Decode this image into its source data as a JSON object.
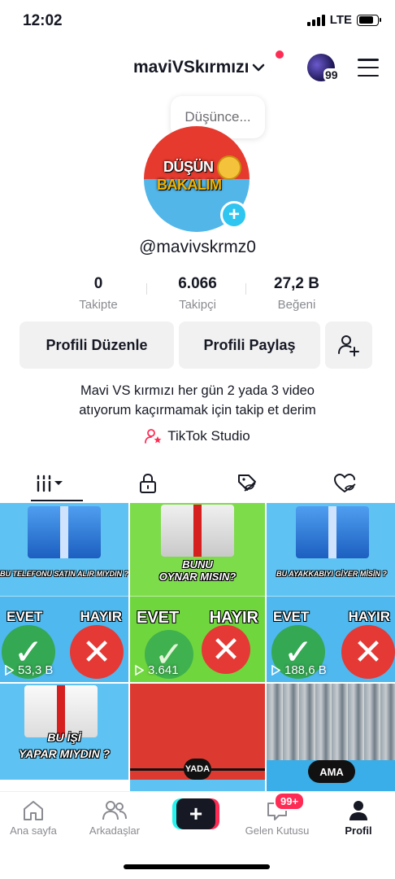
{
  "status_bar": {
    "time": "12:02",
    "network": "LTE"
  },
  "header": {
    "username": "maviVSkırmızı",
    "notification_count": "99"
  },
  "profile": {
    "thought_placeholder": "Düşünce...",
    "avatar_text_line1": "DÜŞÜN",
    "avatar_text_line2": "BAKALIM",
    "handle": "@mavivskrmz0",
    "stats": [
      {
        "value": "0",
        "label": "Takipte"
      },
      {
        "value": "6.066",
        "label": "Takipçi"
      },
      {
        "value": "27,2 B",
        "label": "Beğeni"
      }
    ],
    "buttons": {
      "edit": "Profili Düzenle",
      "share": "Profili Paylaş"
    },
    "bio_line1": "Mavi VS kırmızı her gün 2 yada 3 video",
    "bio_line2": "atıyorum kaçırmamak için takip et derim",
    "studio": "TikTok Studio"
  },
  "videos": [
    {
      "question": "BU TELEFONU SATIN ALIR MIYDIN ?",
      "yes": "EVET",
      "no": "HAYIR",
      "views": "53,3 B"
    },
    {
      "question_line1": "BUNU",
      "question_line2": "OYNAR MISIN?",
      "yes": "EVET",
      "no": "HAYIR",
      "views": "3.641"
    },
    {
      "question": "BU AYAKKABIYI GİYER MİSİN ?",
      "yes": "EVET",
      "no": "HAYIR",
      "views": "188,6 B"
    },
    {
      "question_line1": "BU İŞİ",
      "question_line2": "YAPAR MIYDIN ?"
    },
    {
      "label": "YADA"
    },
    {
      "label": "AMA"
    }
  ],
  "bottom_nav": {
    "home": "Ana sayfa",
    "friends": "Arkadaşlar",
    "inbox": "Gelen Kutusu",
    "inbox_badge": "99+",
    "profile": "Profil"
  },
  "colors": {
    "accent": "#fe2c55",
    "cyan": "#25f4ee",
    "text": "#161823"
  }
}
